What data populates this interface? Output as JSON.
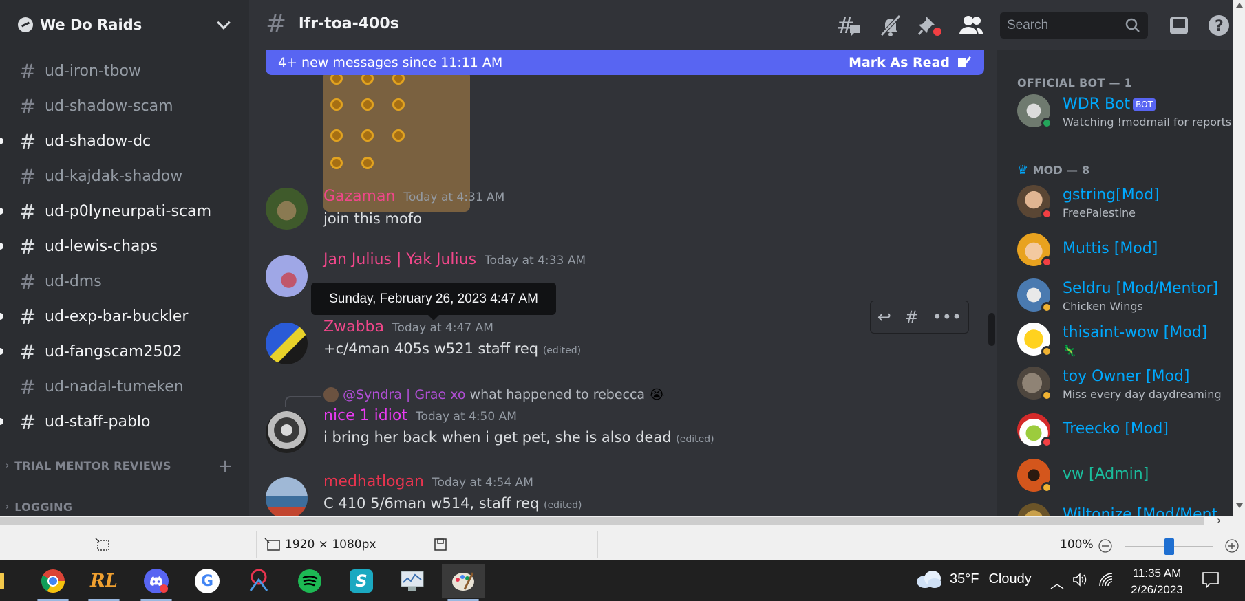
{
  "server": {
    "name": "We Do Raids"
  },
  "channels": [
    {
      "name": "ud-iron-tbow",
      "unread": false
    },
    {
      "name": "ud-shadow-scam",
      "unread": false
    },
    {
      "name": "ud-shadow-dc",
      "unread": true
    },
    {
      "name": "ud-kajdak-shadow",
      "unread": false
    },
    {
      "name": "ud-p0lyneurpati-scam",
      "unread": true
    },
    {
      "name": "ud-lewis-chaps",
      "unread": true
    },
    {
      "name": "ud-dms",
      "unread": false
    },
    {
      "name": "ud-exp-bar-buckler",
      "unread": true
    },
    {
      "name": "ud-fangscam2502",
      "unread": true
    },
    {
      "name": "ud-nadal-tumeken",
      "unread": false
    },
    {
      "name": "ud-staff-pablo",
      "unread": true
    }
  ],
  "categories": [
    {
      "name": "TRIAL MENTOR REVIEWS"
    },
    {
      "name": "LOGGING"
    }
  ],
  "topbar": {
    "channel": "lfr-toa-400s",
    "search_placeholder": "Search"
  },
  "new_messages": {
    "text": "4+ new messages since 11:11 AM",
    "mark_read": "Mark As Read"
  },
  "messages": [
    {
      "author": "Gazaman",
      "color": "#f0478a",
      "time": "Today at 4:31 AM",
      "text": "join this mofo",
      "edited": ""
    },
    {
      "author": "Jan Julius | Yak Julius",
      "color": "#f0478a",
      "time": "Today at 4:33 AM",
      "text": "",
      "edited": ""
    },
    {
      "author": "Zwabba",
      "color": "#f0478a",
      "time": "Today at 4:47 AM",
      "text": "+c/4man 405s w521 staff req",
      "edited": "(edited)"
    },
    {
      "author": "nice 1 idiot",
      "color": "#e83bf0",
      "time": "Today at 4:50 AM",
      "text": "i bring her back when i get pet, she is also dead",
      "edited": "(edited)"
    },
    {
      "author": "medhatlogan",
      "color": "#e8344f",
      "time": "Today at 4:54 AM",
      "text": "C 410 5/6man w514, staff req",
      "edited": "(edited)"
    }
  ],
  "reply": {
    "mention": "@Syndra | Grae xo",
    "text": "what happened to rebecca",
    "emoji": "😭"
  },
  "tooltip": {
    "text": "Sunday, February 26, 2023 4:47 AM"
  },
  "member_list": {
    "roles": [
      {
        "name": "OFFICIAL BOT — 1"
      },
      {
        "name": "MOD — 8"
      }
    ],
    "members": [
      {
        "name": "WDR Bot",
        "tag": "BOT",
        "sub": "Watching !modmail for reports",
        "status": "online",
        "name_color": "#00a8fc"
      },
      {
        "name": "gstring[Mod]",
        "sub": "FreePalestine",
        "status": "dnd",
        "name_color": "#00a8fc"
      },
      {
        "name": "Muttis [Mod]",
        "sub": "",
        "status": "dnd",
        "name_color": "#00a8fc"
      },
      {
        "name": "Seldru [Mod/Mentor]",
        "sub": "Chicken Wings",
        "status": "idle",
        "name_color": "#00a8fc"
      },
      {
        "name": "thisaint-wow [Mod]",
        "sub": "🦎",
        "status": "idle",
        "name_color": "#00a8fc"
      },
      {
        "name": "toy Owner [Mod]",
        "sub": "Miss every day daydreaming",
        "status": "idle",
        "name_color": "#00a8fc"
      },
      {
        "name": "Treecko [Mod]",
        "sub": "",
        "status": "dnd",
        "name_color": "#00a8fc"
      },
      {
        "name": "vw [Admin]",
        "sub": "",
        "status": "idle",
        "name_color": "#1abc9c"
      },
      {
        "name": "Wiltonize [Mod/Ment",
        "sub": "",
        "status": "idle",
        "name_color": "#00a8fc"
      }
    ]
  },
  "paint_status": {
    "dimensions": "1920 × 1080px",
    "zoom": "100%"
  },
  "taskbar": {
    "temperature": "35°F",
    "weather": "Cloudy",
    "time": "11:35 AM",
    "date": "2/26/2023"
  },
  "colors": {
    "blurple": "#5865f2",
    "online": "#23a55a",
    "dnd": "#f23f43",
    "idle": "#f0b232"
  }
}
